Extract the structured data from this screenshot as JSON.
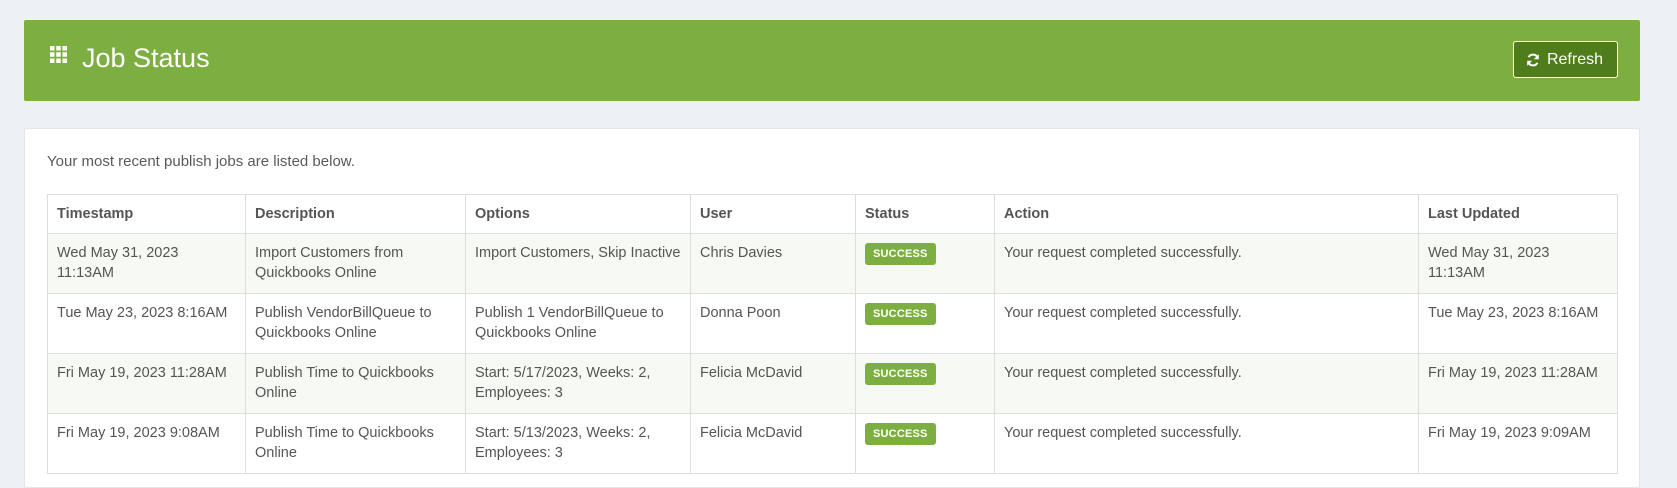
{
  "header": {
    "title": "Job Status",
    "refresh_label": "Refresh",
    "color": "#7cae42",
    "button_color": "#4f7d1b"
  },
  "panel": {
    "intro": "Your most recent publish jobs are listed below."
  },
  "table": {
    "columns": [
      "Timestamp",
      "Description",
      "Options",
      "User",
      "Status",
      "Action",
      "Last Updated"
    ],
    "rows": [
      {
        "timestamp": "Wed May 31, 2023 11:13AM",
        "description": "Import Customers from Quickbooks Online",
        "options": "Import Customers, Skip Inactive",
        "user": "Chris Davies",
        "status": "SUCCESS",
        "action": "Your request completed successfully.",
        "last_updated": "Wed May 31, 2023 11:13AM"
      },
      {
        "timestamp": "Tue May 23, 2023 8:16AM",
        "description": "Publish VendorBillQueue to Quickbooks Online",
        "options": "Publish 1 VendorBillQueue to Quickbooks Online",
        "user": "Donna Poon",
        "status": "SUCCESS",
        "action": "Your request completed successfully.",
        "last_updated": "Tue May 23, 2023 8:16AM"
      },
      {
        "timestamp": "Fri May 19, 2023 11:28AM",
        "description": "Publish Time to Quickbooks Online",
        "options": "Start: 5/17/2023, Weeks: 2, Employees: 3",
        "user": "Felicia McDavid",
        "status": "SUCCESS",
        "action": "Your request completed successfully.",
        "last_updated": "Fri May 19, 2023 11:28AM"
      },
      {
        "timestamp": "Fri May 19, 2023 9:08AM",
        "description": "Publish Time to Quickbooks Online",
        "options": "Start: 5/13/2023, Weeks: 2, Employees: 3",
        "user": "Felicia McDavid",
        "status": "SUCCESS",
        "action": "Your request completed successfully.",
        "last_updated": "Fri May 19, 2023 9:09AM"
      }
    ]
  },
  "icons": {
    "header": "grid-icon",
    "refresh": "refresh-icon"
  }
}
